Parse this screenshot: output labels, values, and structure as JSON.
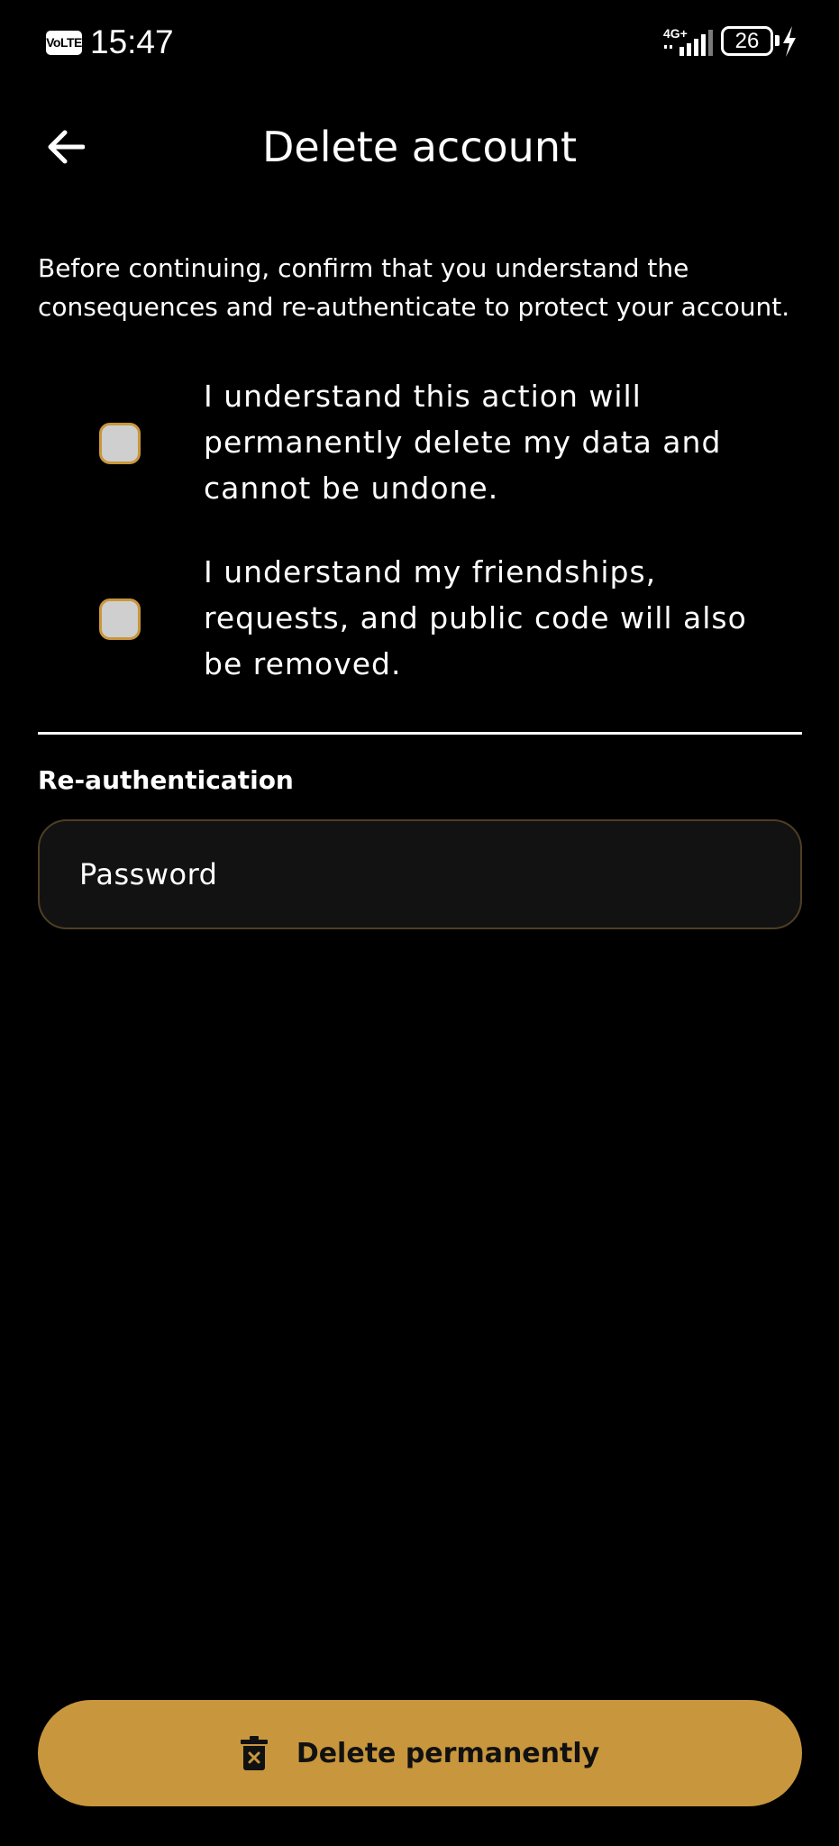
{
  "status_bar": {
    "volte_label": "VoLTE",
    "time": "15:47",
    "network": "4G+",
    "battery_level": "26",
    "icons": [
      "volte-icon",
      "signal-icon",
      "battery-icon",
      "charging-icon"
    ]
  },
  "header": {
    "title": "Delete account",
    "back_icon": "arrow-left-icon"
  },
  "intro": "Before continuing, confirm that you understand the consequences and re-authenticate to protect your account.",
  "confirmations": [
    {
      "label": "I understand this action will permanently delete my data and cannot be undone.",
      "checked": false
    },
    {
      "label": "I understand my friendships, requests, and public code will also be removed.",
      "checked": false
    }
  ],
  "reauth": {
    "section_label": "Re-authentication",
    "password_placeholder": "Password",
    "password_value": ""
  },
  "action": {
    "label": "Delete permanently",
    "icon": "trash-icon"
  },
  "colors": {
    "background": "#000000",
    "accent": "#c8963c",
    "field_background": "#121212",
    "checkbox_fill": "#cfcfcf"
  }
}
